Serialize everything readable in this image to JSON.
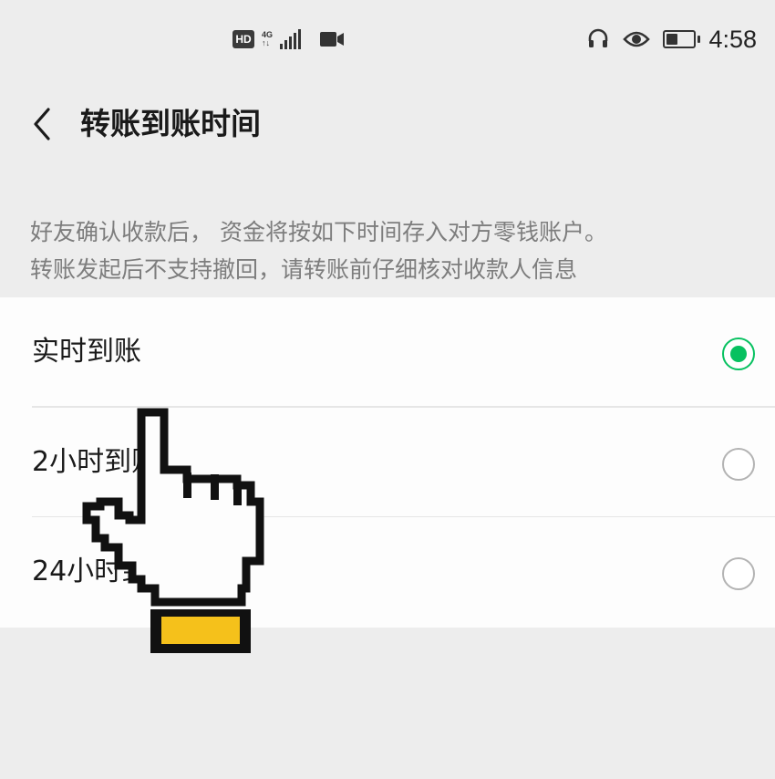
{
  "status_bar": {
    "hd_badge": "HD",
    "network_type_top": "4G",
    "network_type_bottom": "↑↓",
    "time": "4:58",
    "icons": [
      "hd-icon",
      "signal-icon",
      "video-icon",
      "headset-icon",
      "eye-icon",
      "battery-icon"
    ]
  },
  "header": {
    "back_icon": "chevron-left-icon",
    "title": "转账到账时间"
  },
  "description": {
    "line1": "好友确认收款后， 资金将按如下时间存入对方零钱账户。",
    "line2": "转账发起后不支持撤回，请转账前仔细核对收款人信息"
  },
  "options": [
    {
      "label": "实时到账",
      "selected": true
    },
    {
      "label": "2小时到账",
      "selected": false
    },
    {
      "label": "24小时到账",
      "selected": false
    }
  ],
  "colors": {
    "accent": "#07c160",
    "background": "#ededed",
    "card": "#fdfdfd",
    "description_text": "#7d7d7d",
    "hand_cuff": "#f5c11b"
  }
}
